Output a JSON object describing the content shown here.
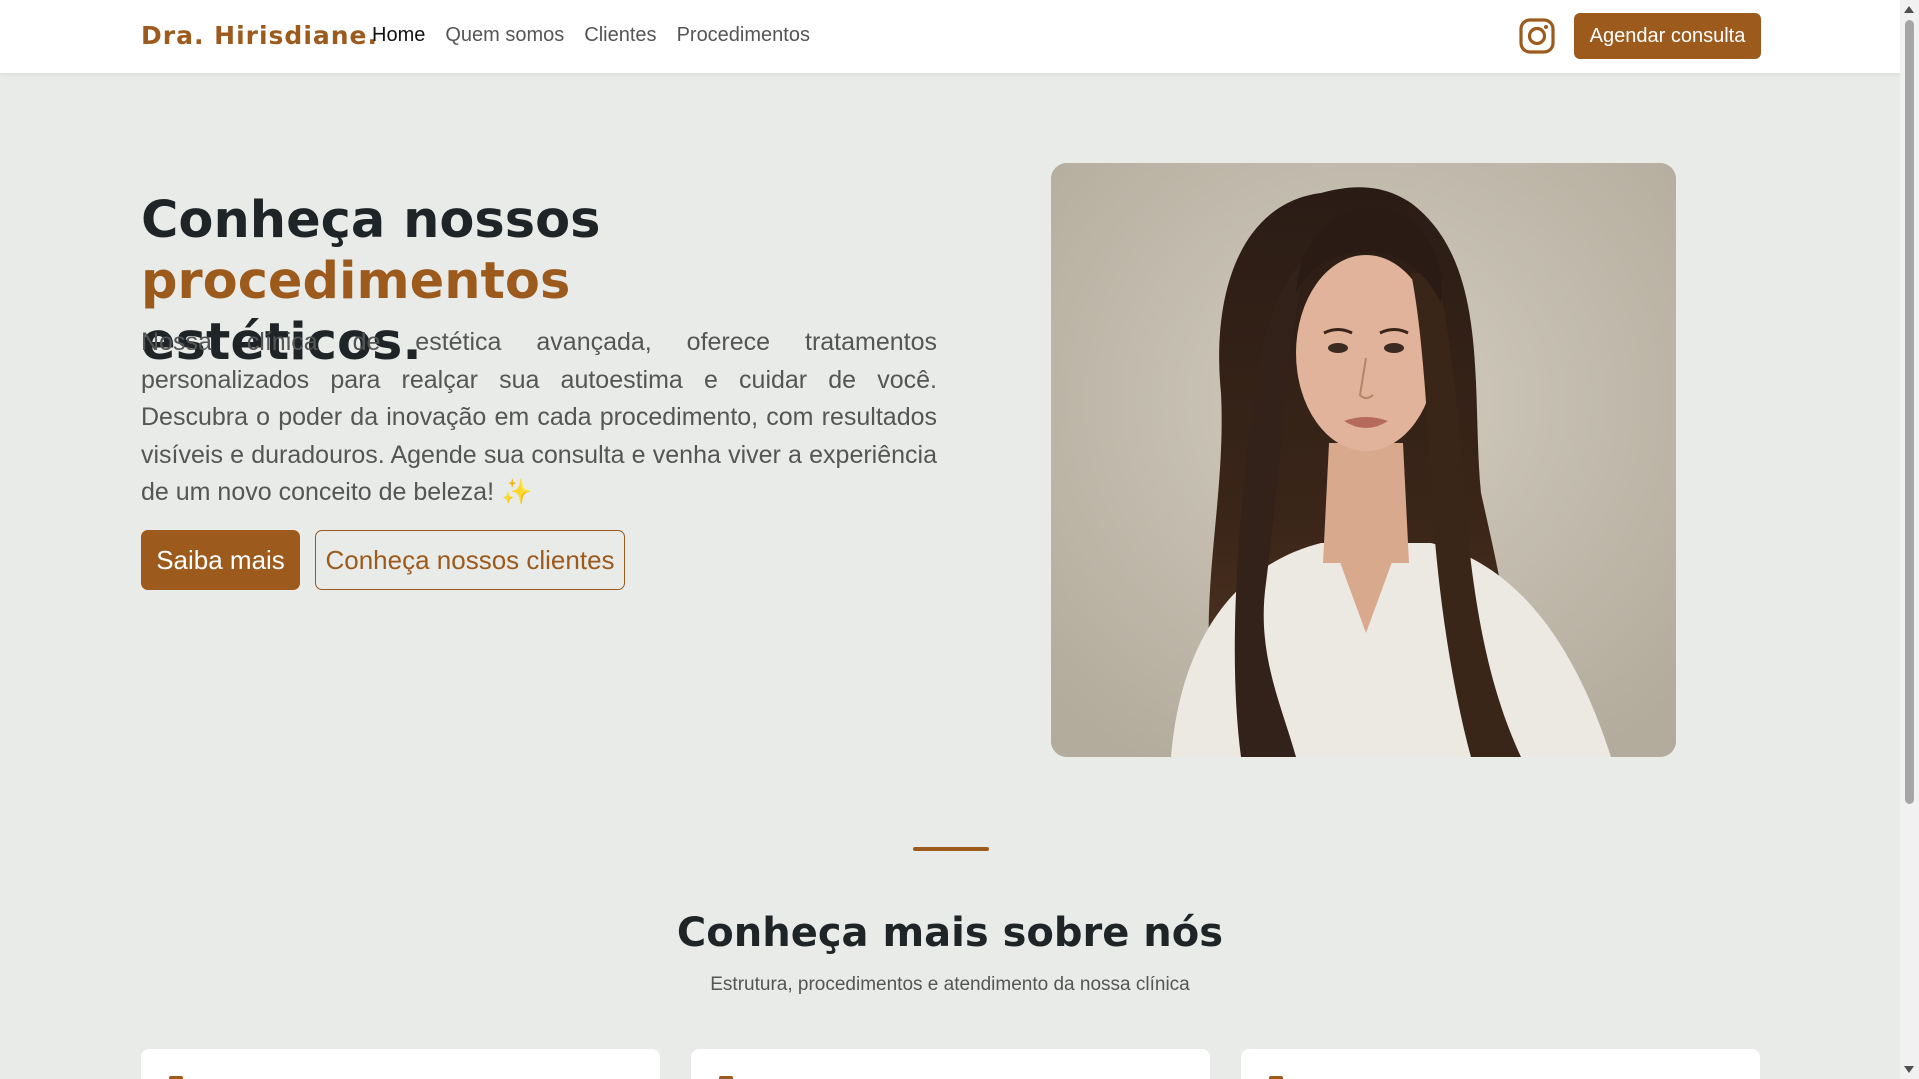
{
  "navbar": {
    "brand": "Dra. Hirisdiane.",
    "links": [
      {
        "label": "Home",
        "active": true
      },
      {
        "label": "Quem somos",
        "active": false
      },
      {
        "label": "Clientes",
        "active": false
      },
      {
        "label": "Procedimentos",
        "active": false
      }
    ],
    "instagram_icon": "instagram-icon",
    "cta_label": "Agendar consulta"
  },
  "hero": {
    "title_start": "Conheça nossos ",
    "title_accent": "procedimentos",
    "title_end": "estéticos.",
    "description": "Nossa clínica de estética avançada, oferece tratamentos personalizados para realçar sua autoestima e cuidar de você. Descubra o poder da inovação em cada procedimento, com resultados visíveis e duradouros. Agende sua consulta e venha viver a experiência de um novo conceito de beleza! ✨",
    "primary_button": "Saiba mais",
    "secondary_button": "Conheça nossos clientes"
  },
  "about": {
    "title": "Conheça mais sobre nós",
    "subtitle": "Estrutura, procedimentos e atendimento da nossa clínica"
  },
  "colors": {
    "accent": "#9c5a1d",
    "background": "#e8ebe8",
    "heading": "#1f2427"
  }
}
